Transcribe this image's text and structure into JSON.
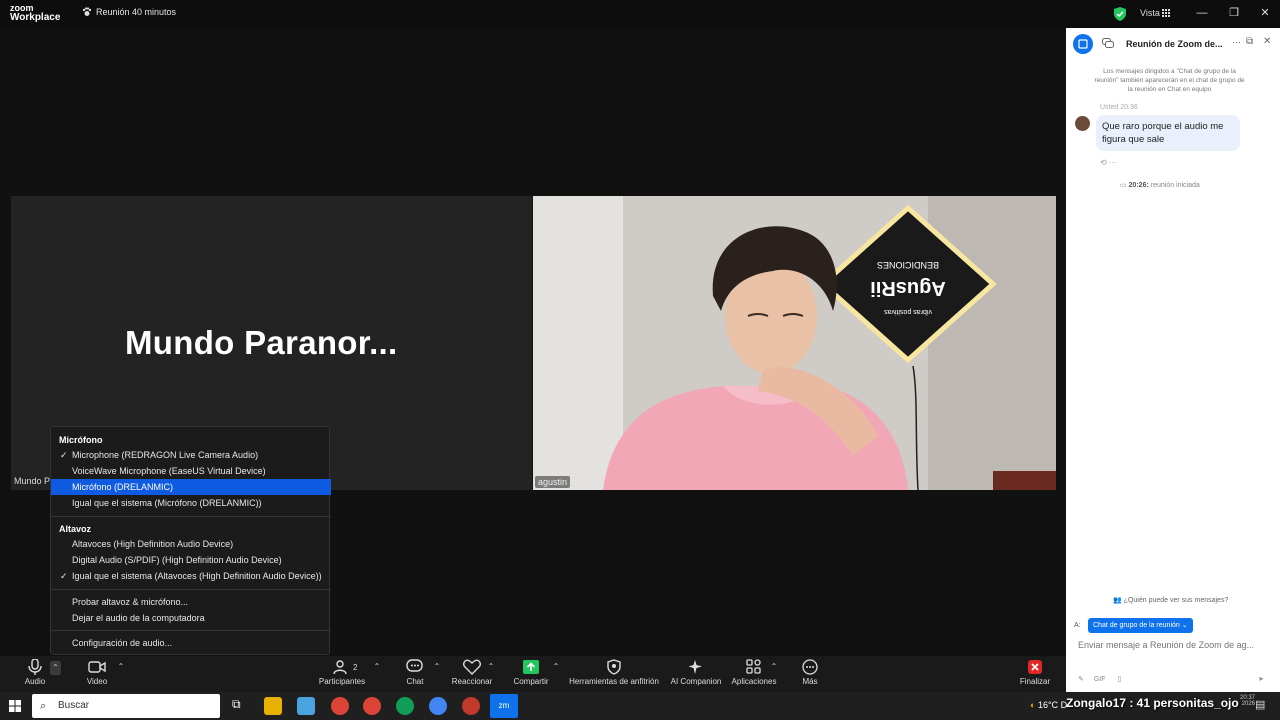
{
  "titlebar": {
    "logo_line1": "zoom",
    "logo_line2": "Workplace",
    "timer": "Reunión 40 minutos",
    "view_label": "Vista"
  },
  "stage": {
    "left_tile_name": "Mundo  Paranor...",
    "left_tile_label": "Mundo P",
    "right_tile_label": "agustin",
    "sign_text_top": "BENDICIONES",
    "sign_text_main": "AgusRii",
    "sign_text_bottom": "vibras positivas"
  },
  "audio_menu": {
    "mic_header": "Micrófono",
    "mic_items": [
      {
        "label": "Microphone (REDRAGON Live Camera Audio)",
        "checked": true
      },
      {
        "label": "VoiceWave Microphone (EaseUS Virtual Device)",
        "checked": false
      },
      {
        "label": "Micrófono (DRELANMIC)",
        "checked": false,
        "highlighted": true
      },
      {
        "label": "Igual que el sistema (Micrófono (DRELANMIC))",
        "checked": false
      }
    ],
    "speaker_header": "Altavoz",
    "speaker_items": [
      {
        "label": "Altavoces (High Definition Audio Device)",
        "checked": false
      },
      {
        "label": "Digital Audio (S/PDIF) (High Definition Audio Device)",
        "checked": false
      },
      {
        "label": "Igual que el sistema (Altavoces (High Definition Audio Device))",
        "checked": true
      }
    ],
    "test_label": "Probar altavoz & micrófono...",
    "leave_label": "Dejar el audio de la computadora",
    "settings_label": "Configuración de audio..."
  },
  "toolbar": {
    "audio": "Audio",
    "video": "Video",
    "participants": "Participantes",
    "participants_count": "2",
    "chat": "Chat",
    "react": "Reaccionar",
    "share": "Compartir",
    "host_tools": "Herramientas de anfitrión",
    "companion": "AI Companion",
    "apps": "Aplicaciones",
    "more": "Más",
    "end": "Finalizar"
  },
  "chat": {
    "title": "Reunión de Zoom de...",
    "note": "Los mensajes dirigidos a \"Chat de grupo de la reunión\" también aparecerán en el chat de grupo de la reunión en Chat en equipo",
    "sender": "Usted 20:36",
    "message": "Que raro porque el audio me figura que sale",
    "actions": "⟲   ···",
    "event_time": "20:26:",
    "event_text": " reunión iniciada",
    "privacy": "¿Quién puede ver sus mensajes?",
    "to_label": "A:",
    "to_pill": "Chat de grupo de la reunión ⌄",
    "input_placeholder": "Enviar mensaje a Reunión de Zoom de ag...",
    "tools": "GIF"
  },
  "taskbar": {
    "search_placeholder": "Buscar",
    "weather": "16°C",
    "weather_trail": "D",
    "overlay": "Zongalo17 : 41 personitas_ojo",
    "time": "20:37",
    "date": "2026"
  },
  "colors": {
    "accent": "#0e72ed",
    "menu_highlight": "#0e5ae0",
    "share_green": "#23c55e",
    "end_red": "#e02828"
  }
}
